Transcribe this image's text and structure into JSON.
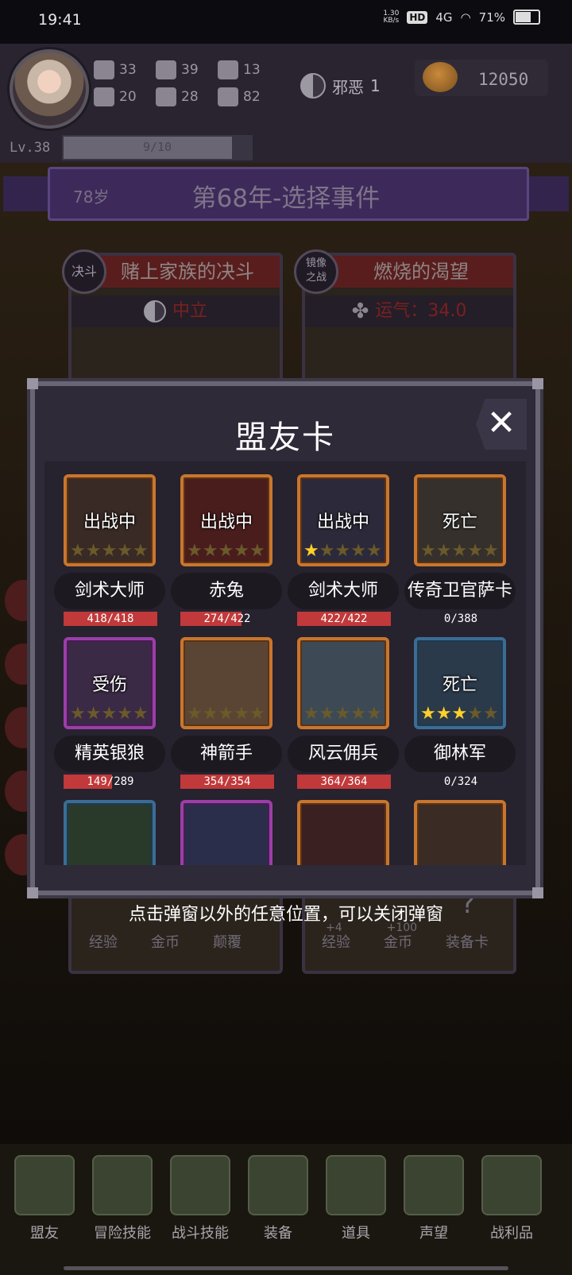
{
  "status": {
    "time": "19:41",
    "speed": "1.30\nKB/s",
    "hd": "HD",
    "network": "4G",
    "battery": "71%"
  },
  "player": {
    "stats": [
      {
        "icon": "fist-icon",
        "value": "33"
      },
      {
        "icon": "boot-icon",
        "value": "39"
      },
      {
        "icon": "wizard-hat-icon",
        "value": "13"
      },
      {
        "icon": "clover-icon",
        "value": "20"
      },
      {
        "icon": "armor-icon",
        "value": "28"
      },
      {
        "icon": "lotus-icon",
        "value": "82"
      }
    ],
    "alignment": "邪恶",
    "alignment_value": "1",
    "gold": "12050",
    "level": "Lv.38",
    "xp": "9/10",
    "xp_progress": 0.9
  },
  "event": {
    "age": "78岁",
    "year_title": "第68年-选择事件",
    "cards": [
      {
        "badge": "决斗",
        "title": "赌上家族的决斗",
        "requirement": "中立",
        "req_icon": "yin-yang-icon"
      },
      {
        "badge": "镜像之战",
        "title": "燃烧的渴望",
        "requirement": "运气：34.0",
        "req_icon": "clover-icon"
      }
    ],
    "bottom_left": [
      "经验",
      "金币",
      "颠覆"
    ],
    "bottom_right": [
      "+4",
      "+100",
      "?"
    ],
    "bottom_right_labels": [
      "经验",
      "金币",
      "装备卡"
    ]
  },
  "popup": {
    "title": "盟友卡",
    "close": "✕",
    "allies": [
      {
        "name": "剑术大师",
        "status": "出战中",
        "hp": "418/418",
        "hp_ratio": 1.0,
        "stars": 0,
        "frame": "orange"
      },
      {
        "name": "赤兔",
        "status": "出战中",
        "hp": "274/422",
        "hp_ratio": 0.65,
        "stars": 0,
        "frame": "orange"
      },
      {
        "name": "剑术大师",
        "status": "出战中",
        "hp": "422/422",
        "hp_ratio": 1.0,
        "stars": 1,
        "frame": "orange"
      },
      {
        "name": "传奇卫官萨卡",
        "status": "死亡",
        "hp": "0/388",
        "hp_ratio": 0,
        "stars": 0,
        "frame": "orange"
      },
      {
        "name": "精英银狼",
        "status": "受伤",
        "hp": "149/289",
        "hp_ratio": 0.52,
        "stars": 0,
        "frame": "purple"
      },
      {
        "name": "神箭手",
        "status": "",
        "hp": "354/354",
        "hp_ratio": 1.0,
        "stars": 0,
        "frame": "orange"
      },
      {
        "name": "风云佣兵",
        "status": "",
        "hp": "364/364",
        "hp_ratio": 1.0,
        "stars": 0,
        "frame": "orange"
      },
      {
        "name": "御林军",
        "status": "死亡",
        "hp": "0/324",
        "hp_ratio": 0,
        "stars": 3,
        "frame": "blue"
      },
      {
        "name": "",
        "status": "",
        "hp": "",
        "hp_ratio": 0,
        "stars": 0,
        "frame": "blue"
      },
      {
        "name": "",
        "status": "",
        "hp": "",
        "hp_ratio": 0,
        "stars": 0,
        "frame": "purple"
      },
      {
        "name": "",
        "status": "",
        "hp": "",
        "hp_ratio": 0,
        "stars": 0,
        "frame": "orange"
      },
      {
        "name": "",
        "status": "",
        "hp": "",
        "hp_ratio": 0,
        "stars": 0,
        "frame": "orange"
      }
    ],
    "hint": "点击弹窗以外的任意位置，可以关闭弹窗"
  },
  "nav": [
    {
      "label": "盟友",
      "icon": "handshake-icon"
    },
    {
      "label": "冒险技能",
      "icon": "book-icon"
    },
    {
      "label": "战斗技能",
      "icon": "backpack-icon"
    },
    {
      "label": "装备",
      "icon": "swords-icon"
    },
    {
      "label": "道具",
      "icon": "amulet-icon"
    },
    {
      "label": "声望",
      "icon": "scroll-icon"
    },
    {
      "label": "战利品",
      "icon": "chest-icon"
    }
  ]
}
